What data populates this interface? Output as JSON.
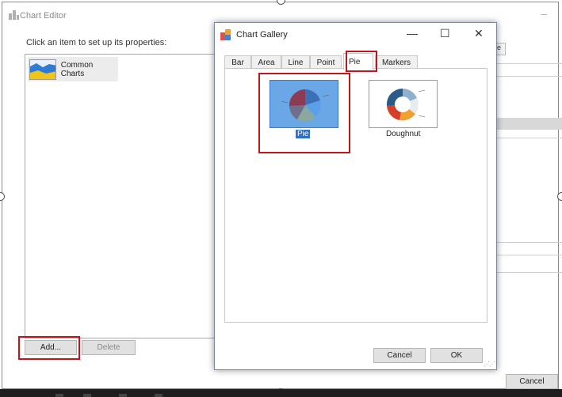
{
  "editor": {
    "title": "Chart Editor",
    "prompt": "Click an item to set up  its properties:",
    "list_items": [
      {
        "label": "Common Charts",
        "icon": "area-chart-icon"
      }
    ],
    "add_label": "Add...",
    "delete_label": "Delete",
    "cancel_label": "Cancel",
    "close_glyph": "–",
    "side_tab_label": "e"
  },
  "gallery": {
    "title": "Chart Gallery",
    "minimize_glyph": "—",
    "maximize_glyph": "☐",
    "close_glyph": "✕",
    "tabs": [
      {
        "label": "Bar",
        "selected": false
      },
      {
        "label": "Area",
        "selected": false
      },
      {
        "label": "Line",
        "selected": false
      },
      {
        "label": "Point",
        "selected": false
      },
      {
        "label": "Pie",
        "selected": true
      },
      {
        "label": "Markers",
        "selected": false
      }
    ],
    "items": [
      {
        "label": "Pie",
        "selected": true,
        "icon": "pie-chart-icon"
      },
      {
        "label": "Doughnut",
        "selected": false,
        "icon": "doughnut-chart-icon"
      }
    ],
    "cancel_label": "Cancel",
    "ok_label": "OK"
  },
  "colors": {
    "highlight_box": "#c0151d",
    "selection_blue": "#2e6fc7",
    "thumbnail_selected_bg": "#6aa7e6"
  }
}
